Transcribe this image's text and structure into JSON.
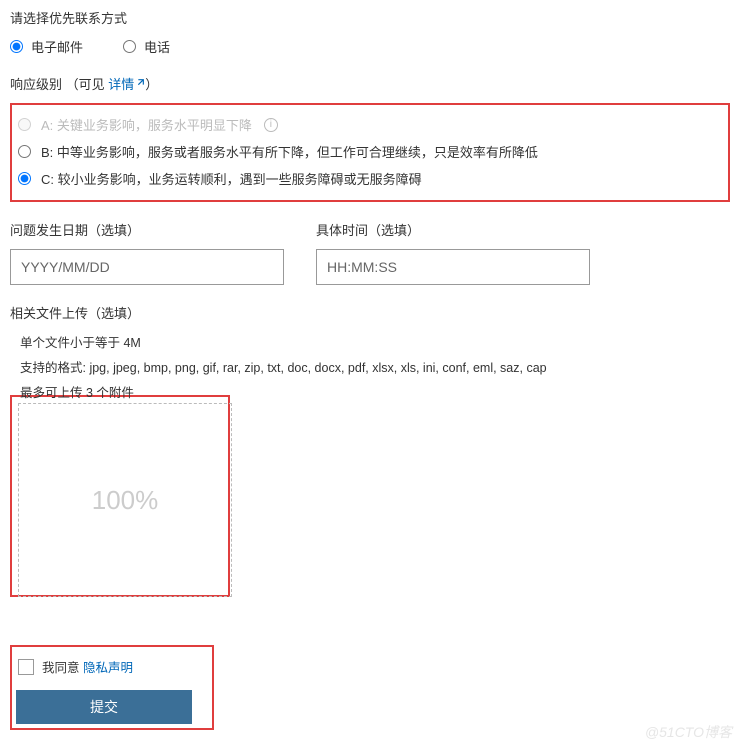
{
  "contact": {
    "title": "请选择优先联系方式",
    "options": {
      "email": "电子邮件",
      "phone": "电话"
    }
  },
  "severity": {
    "title_prefix": "响应级别",
    "paren_open": "（可见 ",
    "details_link": "详情",
    "paren_close": "）",
    "a": "A: 关键业务影响，服务水平明显下降",
    "b": "B: 中等业务影响，服务或者服务水平有所下降，但工作可合理继续，只是效率有所降低",
    "c": "C: 较小业务影响，业务运转顺利，遇到一些服务障碍或无服务障碍"
  },
  "datetime": {
    "date_label": "问题发生日期（选填）",
    "date_placeholder": "YYYY/MM/DD",
    "time_label": "具体时间（选填）",
    "time_placeholder": "HH:MM:SS"
  },
  "upload": {
    "title": "相关文件上传（选填）",
    "hint1": "单个文件小于等于 4M",
    "hint2": "支持的格式: jpg, jpeg, bmp, png, gif, rar, zip, txt, doc, docx, pdf, xlsx, xls, ini, conf, eml, saz, cap",
    "hint3": "最多可上传 3 个附件",
    "progress": "100%"
  },
  "agreement": {
    "agree_text": "我同意 ",
    "privacy_link": "隐私声明"
  },
  "submit": {
    "label": "提交"
  },
  "watermark": "@51CTO博客"
}
